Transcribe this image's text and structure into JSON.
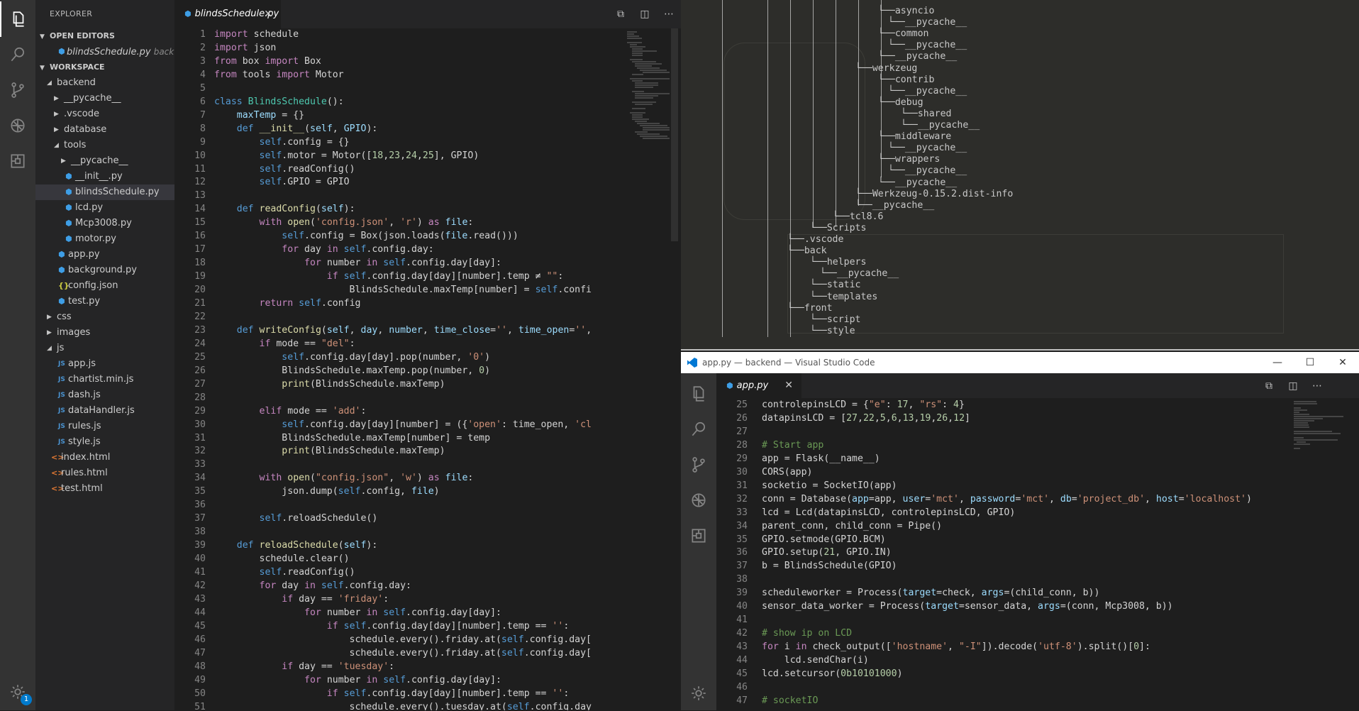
{
  "left_window": {
    "explorer_title": "EXPLORER",
    "open_editors_label": "OPEN EDITORS",
    "open_editor_file": "blindsSchedule.py",
    "open_editor_path": "back...",
    "workspace_label": "WORKSPACE",
    "tree": [
      {
        "label": "backend",
        "kind": "folder-open",
        "depth": 0
      },
      {
        "label": "__pycache__",
        "kind": "folder",
        "depth": 1
      },
      {
        "label": ".vscode",
        "kind": "folder",
        "depth": 1
      },
      {
        "label": "database",
        "kind": "folder",
        "depth": 1
      },
      {
        "label": "tools",
        "kind": "folder-open",
        "depth": 1
      },
      {
        "label": "__pycache__",
        "kind": "folder",
        "depth": 2
      },
      {
        "label": "__init__.py",
        "kind": "py",
        "depth": 2
      },
      {
        "label": "blindsSchedule.py",
        "kind": "py",
        "depth": 2,
        "selected": true
      },
      {
        "label": "lcd.py",
        "kind": "py",
        "depth": 2
      },
      {
        "label": "Mcp3008.py",
        "kind": "py",
        "depth": 2
      },
      {
        "label": "motor.py",
        "kind": "py",
        "depth": 2
      },
      {
        "label": "app.py",
        "kind": "py",
        "depth": 1
      },
      {
        "label": "background.py",
        "kind": "py",
        "depth": 1
      },
      {
        "label": "config.json",
        "kind": "json",
        "depth": 1
      },
      {
        "label": "test.py",
        "kind": "py",
        "depth": 1
      },
      {
        "label": "css",
        "kind": "folder",
        "depth": 0
      },
      {
        "label": "images",
        "kind": "folder",
        "depth": 0
      },
      {
        "label": "js",
        "kind": "folder-open",
        "depth": 0
      },
      {
        "label": "app.js",
        "kind": "js",
        "depth": 1
      },
      {
        "label": "chartist.min.js",
        "kind": "js",
        "depth": 1
      },
      {
        "label": "dash.js",
        "kind": "js",
        "depth": 1
      },
      {
        "label": "dataHandler.js",
        "kind": "js",
        "depth": 1
      },
      {
        "label": "rules.js",
        "kind": "js",
        "depth": 1
      },
      {
        "label": "style.js",
        "kind": "js",
        "depth": 1
      },
      {
        "label": "index.html",
        "kind": "html",
        "depth": 0
      },
      {
        "label": "rules.html",
        "kind": "html",
        "depth": 0
      },
      {
        "label": "test.html",
        "kind": "html",
        "depth": 0
      }
    ],
    "tab_label": "blindsSchedule.py",
    "badge_count": "1",
    "file_icon_glyphs": {
      "py": "⬢",
      "js": "JS",
      "json": "{}",
      "html": "<>"
    },
    "code_lines": [
      "<span class='c'>import</span> schedule",
      "<span class='c'>import</span> json",
      "<span class='c'>from</span> box <span class='c'>import</span> Box",
      "<span class='c'>from</span> tools <span class='c'>import</span> Motor",
      "",
      "<span class='k'>class</span> <span class='t'>BlindsSchedule</span>():",
      "    <span class='p'>maxTemp</span> = {}",
      "    <span class='k'>def</span> <span class='f'>__init__</span>(<span class='p'>self</span>, <span class='p'>GPIO</span>):",
      "        <span class='self'>self</span>.config = {}",
      "        <span class='self'>self</span>.motor = Motor([<span class='n'>18</span>,<span class='n'>23</span>,<span class='n'>24</span>,<span class='n'>25</span>], GPIO)",
      "        <span class='self'>self</span>.readConfig()",
      "        <span class='self'>self</span>.GPIO = GPIO",
      "",
      "    <span class='k'>def</span> <span class='f'>readConfig</span>(<span class='p'>self</span>):",
      "        <span class='c'>with</span> <span class='f'>open</span>(<span class='s'>'config.json'</span>, <span class='s'>'r'</span>) <span class='c'>as</span> <span class='p'>file</span>:",
      "            <span class='self'>self</span>.config = Box(json.loads(<span class='p'>file</span>.read()))",
      "            <span class='c'>for</span> day <span class='c'>in</span> <span class='self'>self</span>.config.day:",
      "                <span class='c'>for</span> number <span class='c'>in</span> <span class='self'>self</span>.config.day[day]:",
      "                    <span class='c'>if</span> <span class='self'>self</span>.config.day[day][number].temp ≠ <span class='s'>\"\"</span>:",
      "                        BlindsSchedule.maxTemp[number] = <span class='self'>self</span>.confi",
      "        <span class='c'>return</span> <span class='self'>self</span>.config",
      "",
      "    <span class='k'>def</span> <span class='f'>writeConfig</span>(<span class='p'>self</span>, <span class='p'>day</span>, <span class='p'>number</span>, <span class='p'>time_close</span>=<span class='s'>''</span>, <span class='p'>time_open</span>=<span class='s'>''</span>,",
      "        <span class='c'>if</span> mode == <span class='s'>\"del\"</span>:",
      "            <span class='self'>self</span>.config.day[day].pop(number, <span class='s'>'0'</span>)",
      "            BlindsSchedule.maxTemp.pop(number, <span class='n'>0</span>)",
      "            <span class='f'>print</span>(BlindsSchedule.maxTemp)",
      "",
      "        <span class='c'>elif</span> mode == <span class='s'>'add'</span>:",
      "            <span class='self'>self</span>.config.day[day][number] = ({<span class='s'>'open'</span>: time_open, <span class='s'>'cl</span>",
      "            BlindsSchedule.maxTemp[number] = temp",
      "            <span class='f'>print</span>(BlindsSchedule.maxTemp)",
      "",
      "        <span class='c'>with</span> <span class='f'>open</span>(<span class='s'>\"config.json\"</span>, <span class='s'>'w'</span>) <span class='c'>as</span> <span class='p'>file</span>:",
      "            json.dump(<span class='self'>self</span>.config, <span class='p'>file</span>)",
      "",
      "        <span class='self'>self</span>.reloadSchedule()",
      "",
      "    <span class='k'>def</span> <span class='f'>reloadSchedule</span>(<span class='p'>self</span>):",
      "        schedule.clear()",
      "        <span class='self'>self</span>.readConfig()",
      "        <span class='c'>for</span> day <span class='c'>in</span> <span class='self'>self</span>.config.day:",
      "            <span class='c'>if</span> day == <span class='s'>'friday'</span>:",
      "                <span class='c'>for</span> number <span class='c'>in</span> <span class='self'>self</span>.config.day[day]:",
      "                    <span class='c'>if</span> <span class='self'>self</span>.config.day[day][number].temp == <span class='s'>''</span>:",
      "                        schedule.every().friday.at(<span class='self'>self</span>.config.day[",
      "                        schedule.every().friday.at(<span class='self'>self</span>.config.day[",
      "            <span class='c'>if</span> day == <span class='s'>'tuesday'</span>:",
      "                <span class='c'>for</span> number <span class='c'>in</span> <span class='self'>self</span>.config.day[day]:",
      "                    <span class='c'>if</span> <span class='self'>self</span>.config.day[day][number].temp == <span class='s'>''</span>:",
      "                        schedule.every().tuesday.at(<span class='self'>self</span>.config.day"
    ]
  },
  "terminal_tree": [
    "asyncio",
    "└──__pycache__",
    "common",
    "└──__pycache__",
    "__pycache__",
    "werkzeug",
    "contrib",
    "└──__pycache__",
    "debug",
    "shared",
    "└──__pycache__",
    "middleware",
    "└──__pycache__",
    "wrappers",
    "└──__pycache__",
    "__pycache__",
    "Werkzeug-0.15.2.dist-info",
    "__pycache__",
    "tcl8.6",
    "Scripts",
    ".vscode",
    "back",
    "helpers",
    "└──__pycache__",
    "static",
    "templates",
    "front",
    "script",
    "style"
  ],
  "right_window": {
    "title": "app.py — backend — Visual Studio Code",
    "tab_label": "app.py",
    "window_controls": [
      "—",
      "☐",
      "✕"
    ],
    "line_start": 25,
    "code_lines": [
      "controlepinsLCD = {<span class='s'>\"e\"</span>: <span class='n'>17</span>, <span class='s'>\"rs\"</span>: <span class='n'>4</span>}",
      "datapinsLCD = [<span class='n'>27</span>,<span class='n'>22</span>,<span class='n'>5</span>,<span class='n'>6</span>,<span class='n'>13</span>,<span class='n'>19</span>,<span class='n'>26</span>,<span class='n'>12</span>]",
      "",
      "<span class='cm'># Start app</span>",
      "app = Flask(__name__)",
      "CORS(app)",
      "socketio = SocketIO(app)",
      "conn = Database(<span class='p'>app</span>=app, <span class='p'>user</span>=<span class='s'>'mct'</span>, <span class='p'>password</span>=<span class='s'>'mct'</span>, <span class='p'>db</span>=<span class='s'>'project_db'</span>, <span class='p'>host</span>=<span class='s'>'localhost'</span>)",
      "lcd = Lcd(datapinsLCD, controlepinsLCD, GPIO)",
      "parent_conn, child_conn = Pipe()",
      "GPIO.setmode(GPIO.BCM)",
      "GPIO.setup(<span class='n'>21</span>, GPIO.IN)",
      "b = BlindsSchedule(GPIO)",
      "",
      "scheduleworker = Process(<span class='p'>target</span>=check, <span class='p'>args</span>=(child_conn, b))",
      "sensor_data_worker = Process(<span class='p'>target</span>=sensor_data, <span class='p'>args</span>=(conn, Mcp3008, b))",
      "",
      "<span class='cm'># show ip on LCD</span>",
      "<span class='c'>for</span> i <span class='c'>in</span> check_output([<span class='s'>'hostname'</span>, <span class='s'>\"-I\"</span>]).decode(<span class='s'>'utf-8'</span>).split()[<span class='n'>0</span>]:",
      "    lcd.sendChar(i)",
      "lcd.setcursor(<span class='n'>0b10101000</span>)",
      "",
      "<span class='cm'># socketIO</span>"
    ]
  }
}
